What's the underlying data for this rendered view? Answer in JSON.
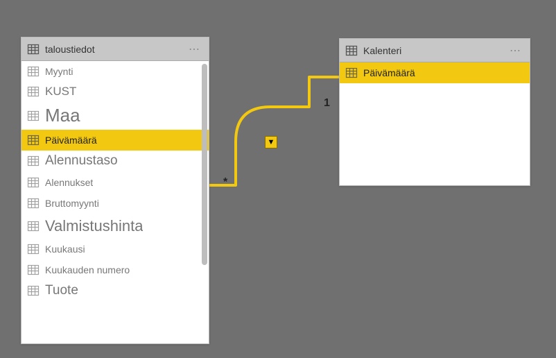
{
  "tables": {
    "left": {
      "title": "taloustiedot",
      "fields": [
        {
          "label": "Myynti",
          "selected": false,
          "size": 14
        },
        {
          "label": "KUST",
          "selected": false,
          "size": 17
        },
        {
          "label": "Maa",
          "selected": false,
          "size": 26
        },
        {
          "label": "Päivämäärä",
          "selected": true,
          "size": 14
        },
        {
          "label": "Alennustaso",
          "selected": false,
          "size": 19
        },
        {
          "label": "Alennukset",
          "selected": false,
          "size": 14
        },
        {
          "label": "Bruttomyynti",
          "selected": false,
          "size": 14
        },
        {
          "label": "Valmistushinta",
          "selected": false,
          "size": 22
        },
        {
          "label": "Kuukausi",
          "selected": false,
          "size": 14
        },
        {
          "label": "Kuukauden numero",
          "selected": false,
          "size": 14
        },
        {
          "label": "Tuote",
          "selected": false,
          "size": 19
        }
      ]
    },
    "right": {
      "title": "Kalenteri",
      "fields": [
        {
          "label": "Päivämäärä",
          "selected": true,
          "size": 14
        }
      ]
    }
  },
  "relationship": {
    "many_label": "*",
    "one_label": "1",
    "arrow_glyph": "▼"
  }
}
